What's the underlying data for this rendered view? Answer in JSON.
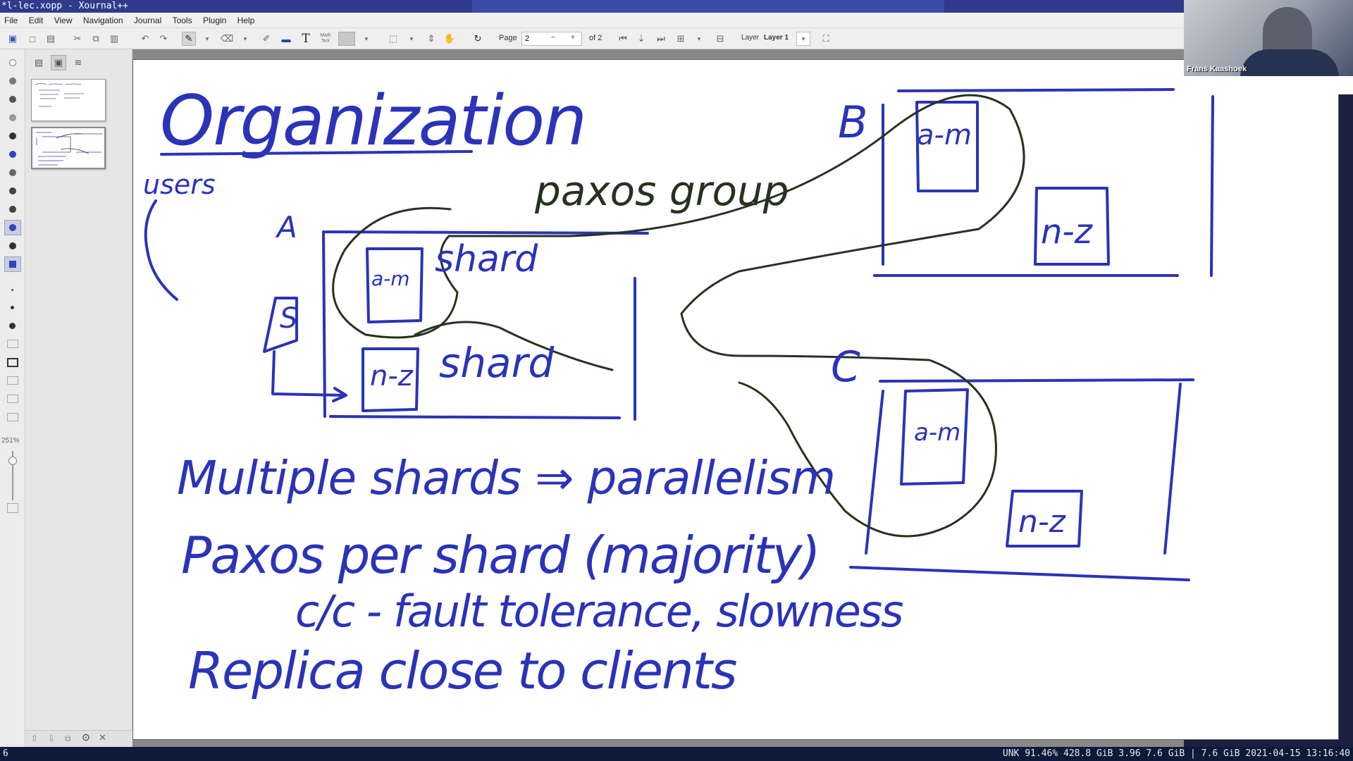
{
  "window": {
    "title": "*l-lec.xopp - Xournal++"
  },
  "menu": {
    "items": [
      "File",
      "Edit",
      "View",
      "Navigation",
      "Journal",
      "Tools",
      "Plugin",
      "Help"
    ]
  },
  "toolbar": {
    "math_tex_label": "Math\nTeX",
    "page_label": "Page",
    "page_value": "2",
    "page_of": "of 2",
    "layer_label": "Layer",
    "layer_value": "Layer 1"
  },
  "sidebar": {
    "zoom_level": "251%"
  },
  "webcam": {
    "name": "Frans Kaashoek"
  },
  "statusbar": {
    "workspace": "6",
    "info": "UNK 91.46% 428.8 GiB 3.96 7.6 GiB | 7.6 GiB 2021-04-15 13:16:40"
  },
  "note": {
    "title": "Organization",
    "users_label": "users",
    "paxos_group": "paxos group",
    "server_a": "A",
    "server_b": "B",
    "server_c": "C",
    "shard_am": "a-m",
    "shard_nz": "n-z",
    "shard_word": "shard",
    "s_label": "S",
    "line1": "Multiple shards ⇒ parallelism",
    "line2": "Paxos per shard (majority)",
    "line3": "c/c - fault tolerance, slowness",
    "line4": "Replica close to clients"
  },
  "colors": {
    "ink_blue": "#2b33b8",
    "ink_dark": "#26321f",
    "page_bg": "#ffffff"
  }
}
